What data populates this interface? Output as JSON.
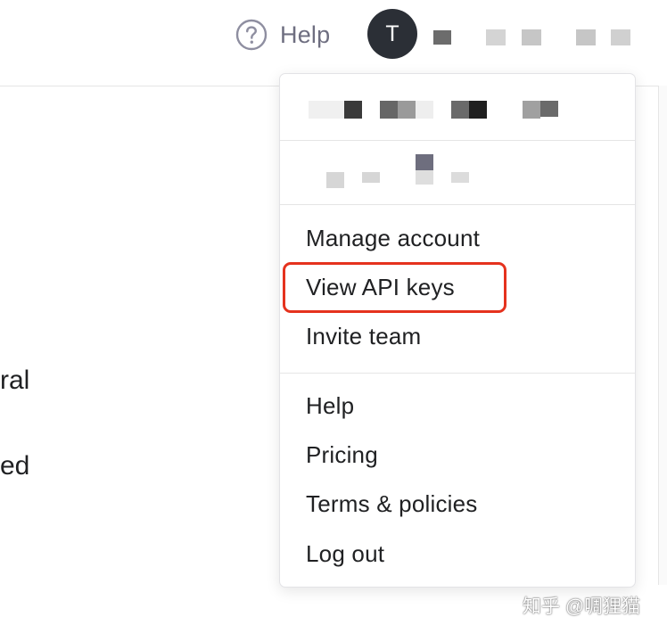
{
  "header": {
    "help_label": "Help",
    "avatar_initial": "T"
  },
  "background": {
    "text_1": "ral",
    "text_2": "ed"
  },
  "menu": {
    "items_group_1": [
      {
        "label": "Manage account"
      },
      {
        "label": "View API keys"
      },
      {
        "label": "Invite team"
      }
    ],
    "items_group_2": [
      {
        "label": "Help"
      },
      {
        "label": "Pricing"
      },
      {
        "label": "Terms & policies"
      },
      {
        "label": "Log out"
      }
    ]
  },
  "watermark": "知乎 @啁狸猫",
  "colors": {
    "highlight": "#e5321e",
    "avatar_bg": "#2b2f36",
    "muted_text": "#6e6e80"
  }
}
